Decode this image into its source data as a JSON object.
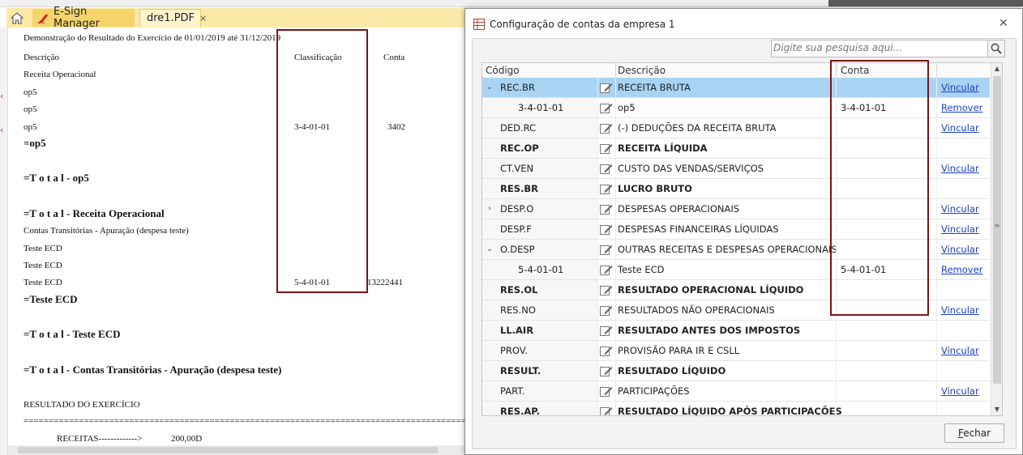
{
  "app": {
    "tabs": [
      {
        "label": "E-Sign Manager"
      },
      {
        "label": "dre1.PDF",
        "close": "×"
      }
    ]
  },
  "document": {
    "header": "Demonstração do Resultado do Exercício de 01/01/2019 até 31/12/2019",
    "col_descricao": "Descrição",
    "col_classificacao": "Classificação",
    "col_conta": "Conta",
    "lines": [
      {
        "text": "Receita Operacional"
      },
      {
        "text": "op5"
      },
      {
        "text": "op5"
      },
      {
        "text": "op5",
        "classificacao": "3-4-01-01",
        "conta": "3402"
      },
      {
        "text": "=op5",
        "bold": true
      },
      {
        "text": "=T o t a l  -  op5",
        "bold": true
      },
      {
        "text": "=T o t a l  -  Receita Operacional",
        "bold": true
      },
      {
        "text": "Contas Transitórias  - Apuração (despesa teste)"
      },
      {
        "text": "Teste ECD"
      },
      {
        "text": "Teste ECD"
      },
      {
        "text": "Teste ECD",
        "classificacao": "5-4-01-01",
        "conta": "13222441"
      },
      {
        "text": "=Teste ECD",
        "bold": true
      },
      {
        "text": "=T o t a l  -  Teste ECD",
        "bold": true
      },
      {
        "text": "=T o t a l  -  Contas Transitórias  - Apuração (despesa teste)",
        "bold": true
      },
      {
        "text": "RESULTADO DO EXERCÍCIO"
      }
    ],
    "separator": "================================================================================================",
    "receitas_label": "RECEITAS------------->",
    "receitas_value": "200,00D"
  },
  "dialog": {
    "title": "Configuração de contas da empresa 1",
    "search_placeholder": "Digite sua pesquisa aqui...",
    "columns": {
      "codigo": "Código",
      "descricao": "Descrição",
      "conta": "Conta"
    },
    "rows": [
      {
        "expander": "⌄",
        "code": "REC.BR",
        "desc": "RECEITA BRUTA",
        "conta": "",
        "action": "Vincular",
        "selected": true,
        "bold": false,
        "child": false
      },
      {
        "expander": "",
        "code": "3-4-01-01",
        "desc": "op5",
        "conta": "3-4-01-01",
        "action": "Remover",
        "selected": false,
        "bold": false,
        "child": true
      },
      {
        "expander": "",
        "code": "DED.RC",
        "desc": "(-) DEDUÇÕES DA RECEITA BRUTA",
        "conta": "",
        "action": "Vincular",
        "selected": false,
        "bold": false,
        "child": false
      },
      {
        "expander": "",
        "code": "REC.OP",
        "desc": "RECEITA LÍQUIDA",
        "conta": "",
        "action": "",
        "selected": false,
        "bold": true,
        "child": false
      },
      {
        "expander": "",
        "code": "CT.VEN",
        "desc": "CUSTO DAS VENDAS/SERVIÇOS",
        "conta": "",
        "action": "Vincular",
        "selected": false,
        "bold": false,
        "child": false
      },
      {
        "expander": "",
        "code": "RES.BR",
        "desc": "LUCRO BRUTO",
        "conta": "",
        "action": "",
        "selected": false,
        "bold": true,
        "child": false
      },
      {
        "expander": "›",
        "code": "DESP.O",
        "desc": "DESPESAS OPERACIONAIS",
        "conta": "",
        "action": "Vincular",
        "selected": false,
        "bold": false,
        "child": false
      },
      {
        "expander": "",
        "code": "DESP.F",
        "desc": "DESPESAS FINANCEIRAS LÍQUIDAS",
        "conta": "",
        "action": "Vincular",
        "selected": false,
        "bold": false,
        "child": false
      },
      {
        "expander": "⌄",
        "code": "O.DESP",
        "desc": "OUTRAS RECEITAS E DESPESAS OPERACIONAIS",
        "conta": "",
        "action": "Vincular",
        "selected": false,
        "bold": false,
        "child": false
      },
      {
        "expander": "",
        "code": "5-4-01-01",
        "desc": "Teste ECD",
        "conta": "5-4-01-01",
        "action": "Remover",
        "selected": false,
        "bold": false,
        "child": true
      },
      {
        "expander": "",
        "code": "RES.OL",
        "desc": "RESULTADO OPERACIONAL LÍQUIDO",
        "conta": "",
        "action": "",
        "selected": false,
        "bold": true,
        "child": false
      },
      {
        "expander": "",
        "code": "RES.NO",
        "desc": "RESULTADOS NÃO OPERACIONAIS",
        "conta": "",
        "action": "Vincular",
        "selected": false,
        "bold": false,
        "child": false
      },
      {
        "expander": "",
        "code": "LL.AIR",
        "desc": "RESULTADO ANTES DOS IMPOSTOS",
        "conta": "",
        "action": "",
        "selected": false,
        "bold": true,
        "child": false
      },
      {
        "expander": "",
        "code": "PROV.",
        "desc": "PROVISÃO PARA IR E CSLL",
        "conta": "",
        "action": "Vincular",
        "selected": false,
        "bold": false,
        "child": false
      },
      {
        "expander": "",
        "code": "RESULT.",
        "desc": "RESULTADO LÍQUIDO",
        "conta": "",
        "action": "",
        "selected": false,
        "bold": true,
        "child": false
      },
      {
        "expander": "",
        "code": "PART.",
        "desc": "PARTICIPAÇÕES",
        "conta": "",
        "action": "Vincular",
        "selected": false,
        "bold": false,
        "child": false
      },
      {
        "expander": "",
        "code": "RES.AP.",
        "desc": "RESULTADO LÍQUIDO APÓS PARTICIPAÇÕES",
        "conta": "",
        "action": "",
        "selected": false,
        "bold": true,
        "child": false
      }
    ],
    "close_button": "Fechar"
  }
}
